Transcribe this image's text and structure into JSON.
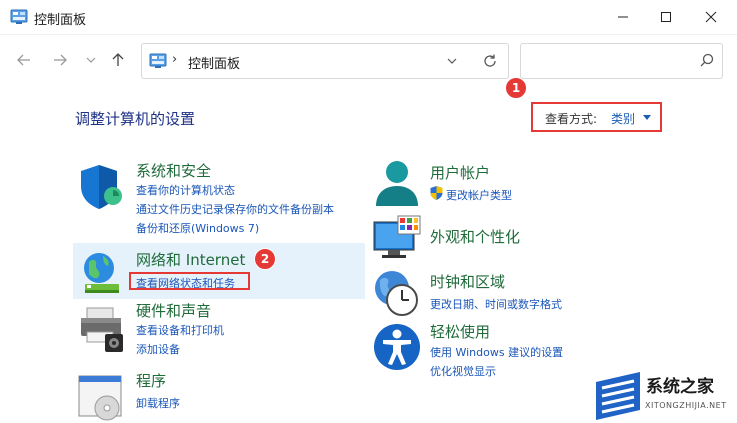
{
  "window": {
    "title": "控制面板"
  },
  "address": {
    "separator": "›",
    "path": "控制面板"
  },
  "search": {
    "placeholder": ""
  },
  "main": {
    "heading": "调整计算机的设置",
    "view_label": "查看方式:",
    "view_value": "类别"
  },
  "badges": {
    "one": "1",
    "two": "2"
  },
  "categories": {
    "system": {
      "title": "系统和安全",
      "links": [
        "查看你的计算机状态",
        "通过文件历史记录保存你的文件备份副本",
        "备份和还原(Windows 7)"
      ]
    },
    "network": {
      "title": "网络和 Internet",
      "links": [
        "查看网络状态和任务"
      ]
    },
    "hardware": {
      "title": "硬件和声音",
      "links": [
        "查看设备和打印机",
        "添加设备"
      ]
    },
    "programs": {
      "title": "程序",
      "links": [
        "卸载程序"
      ]
    },
    "users": {
      "title": "用户帐户",
      "links": [
        "更改帐户类型"
      ]
    },
    "appearance": {
      "title": "外观和个性化",
      "links": []
    },
    "clock": {
      "title": "时钟和区域",
      "links": [
        "更改日期、时间或数字格式"
      ]
    },
    "ease": {
      "title": "轻松使用",
      "links": [
        "使用 Windows 建议的设置",
        "优化视觉显示"
      ]
    }
  },
  "watermark": {
    "title": "系统之家",
    "subtitle": "XITONGZHIJIA.NET"
  },
  "colors": {
    "accent": "#1a5fb4",
    "title_green": "#1f6b3a",
    "highlight": "#e5f1fb",
    "annotation_red": "#e53935"
  }
}
